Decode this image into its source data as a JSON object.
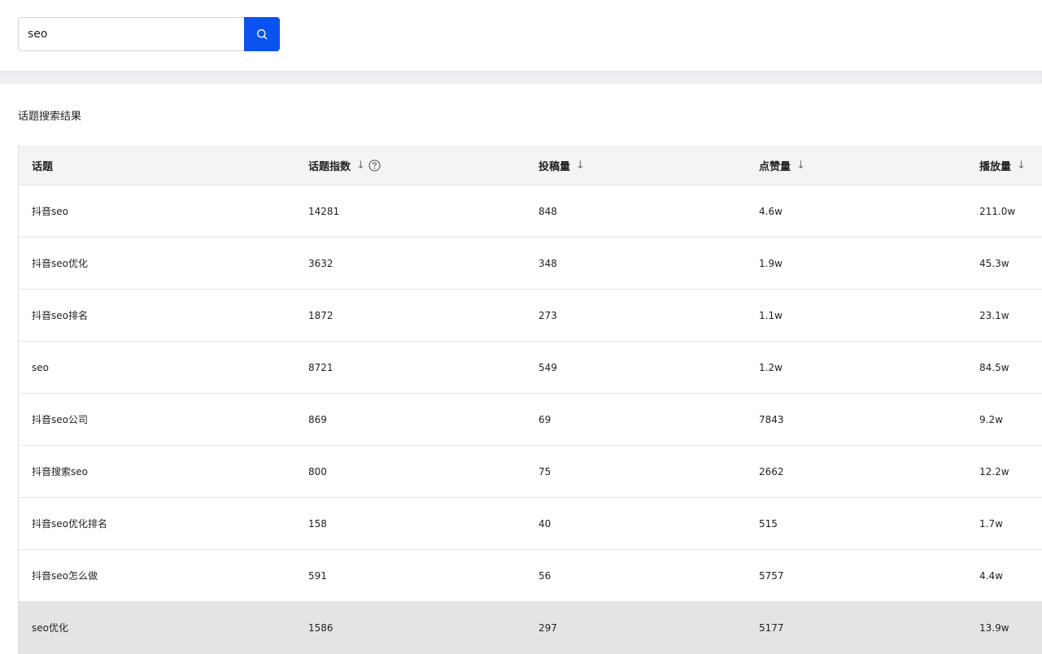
{
  "search": {
    "value": "seo",
    "placeholder": ""
  },
  "section_title": "话题搜索结果",
  "table": {
    "headers": {
      "topic": "话题",
      "index": "话题指数",
      "posts": "投稿量",
      "likes": "点赞量",
      "plays": "播放量",
      "sort_arrow": "↓"
    },
    "rows": [
      {
        "topic": "抖音seo",
        "index": "14281",
        "posts": "848",
        "likes": "4.6w",
        "plays": "211.0w"
      },
      {
        "topic": "抖音seo优化",
        "index": "3632",
        "posts": "348",
        "likes": "1.9w",
        "plays": "45.3w"
      },
      {
        "topic": "抖音seo排名",
        "index": "1872",
        "posts": "273",
        "likes": "1.1w",
        "plays": "23.1w"
      },
      {
        "topic": "seo",
        "index": "8721",
        "posts": "549",
        "likes": "1.2w",
        "plays": "84.5w"
      },
      {
        "topic": "抖音seo公司",
        "index": "869",
        "posts": "69",
        "likes": "7843",
        "plays": "9.2w"
      },
      {
        "topic": "抖音搜索seo",
        "index": "800",
        "posts": "75",
        "likes": "2662",
        "plays": "12.2w"
      },
      {
        "topic": "抖音seo优化排名",
        "index": "158",
        "posts": "40",
        "likes": "515",
        "plays": "1.7w"
      },
      {
        "topic": "抖音seo怎么做",
        "index": "591",
        "posts": "56",
        "likes": "5757",
        "plays": "4.4w"
      },
      {
        "topic": "seo优化",
        "index": "1586",
        "posts": "297",
        "likes": "5177",
        "plays": "13.9w"
      }
    ]
  },
  "colors": {
    "accent": "#0a53f0",
    "header_bg": "#f4f4f4",
    "row_hover_bg": "#e4e4e4",
    "border": "#e4e4e4"
  },
  "icons": {
    "search_button": "search-icon",
    "index_help": "question-circle-icon"
  }
}
